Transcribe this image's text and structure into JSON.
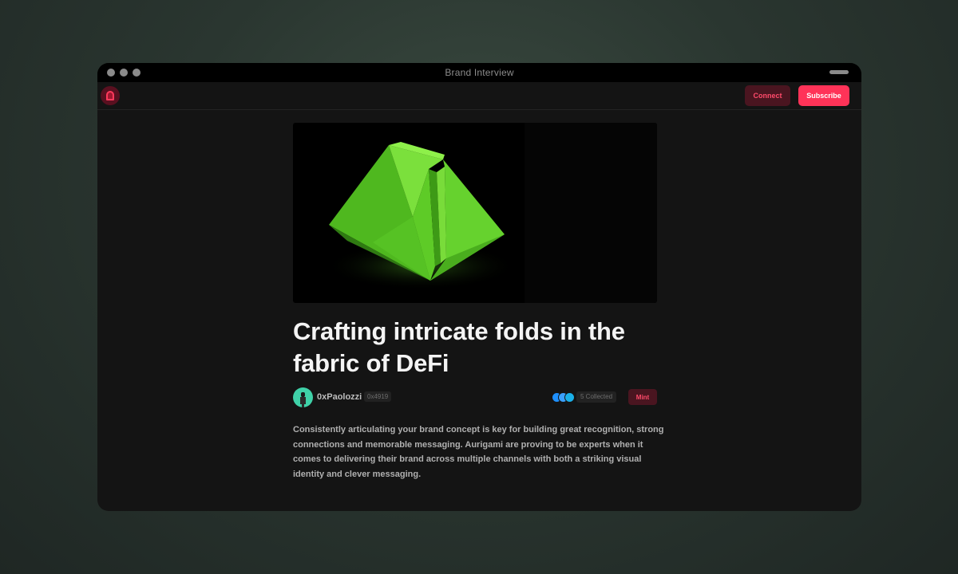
{
  "window": {
    "title": "Brand Interview"
  },
  "header": {
    "connect_label": "Connect",
    "subscribe_label": "Subscribe"
  },
  "article": {
    "headline": "Crafting intricate folds in the fabric of DeFi",
    "author": {
      "name": "0xPaolozzi",
      "address": "0x4919"
    },
    "collected_label": "5 Collected",
    "mint_label": "Mint",
    "body": "Consistently articulating your brand concept is key for building great recognition, strong connections and memorable messaging. Aurigami are proving to be experts when it comes to delivering their brand across multiple channels with both a striking visual identity and clever messaging."
  },
  "colors": {
    "accent": "#ff3358",
    "accent_dark": "#4a1520",
    "background": "#141414",
    "origami_green": "#5ed12a"
  },
  "icons": {
    "logo": "brand-logo-icon",
    "window_controls": [
      "window-dot",
      "window-dot",
      "window-dot"
    ]
  }
}
